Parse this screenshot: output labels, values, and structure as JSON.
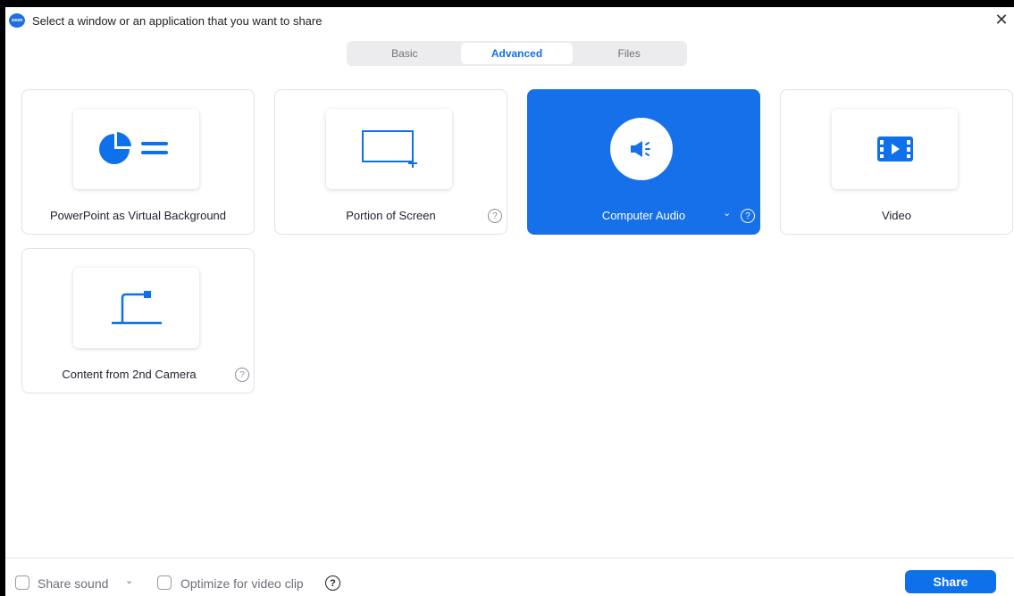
{
  "window": {
    "title": "Select a window or an application that you want to share",
    "logo_text": "zoom",
    "close_glyph": "✕"
  },
  "tabs": [
    {
      "label": "Basic",
      "active": false
    },
    {
      "label": "Advanced",
      "active": true
    },
    {
      "label": "Files",
      "active": false
    }
  ],
  "options": [
    {
      "label": "PowerPoint as Virtual Background",
      "icon": "powerpoint-background-icon",
      "has_help": false,
      "selected": false
    },
    {
      "label": "Portion of Screen",
      "icon": "portion-of-screen-icon",
      "has_help": true,
      "selected": false
    },
    {
      "label": "Computer Audio",
      "icon": "speaker-icon",
      "has_help": true,
      "has_dropdown": true,
      "selected": true
    },
    {
      "label": "Video",
      "icon": "video-file-icon",
      "has_help": false,
      "selected": false
    },
    {
      "label": "Content from 2nd Camera",
      "icon": "document-camera-icon",
      "has_help": true,
      "selected": false
    }
  ],
  "help_glyph": "?",
  "dropdown_glyph": "⌄",
  "bottom": {
    "share_sound_label": "Share sound",
    "share_sound_checked": false,
    "optimize_label": "Optimize for video clip",
    "optimize_checked": false,
    "share_button": "Share"
  },
  "colors": {
    "accent": "#0e71eb",
    "selected_card": "#1570ea"
  }
}
